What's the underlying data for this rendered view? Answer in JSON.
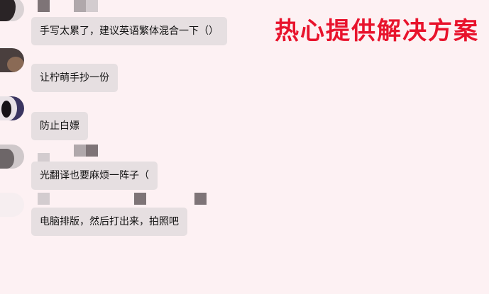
{
  "overlay_title": "热心提供解决方案",
  "messages": [
    {
      "text": "手写太累了，建议英语繁体混合一下（）"
    },
    {
      "text": "让柠萌手抄一份"
    },
    {
      "text": "防止白嫖"
    },
    {
      "text": "光翻译也要麻烦一阵子（"
    },
    {
      "text": "电脑排版，然后打出来，拍照吧"
    }
  ],
  "colors": {
    "background": "#fdf1f3",
    "bubble": "#e6dfe1",
    "title": "#e8132c"
  }
}
